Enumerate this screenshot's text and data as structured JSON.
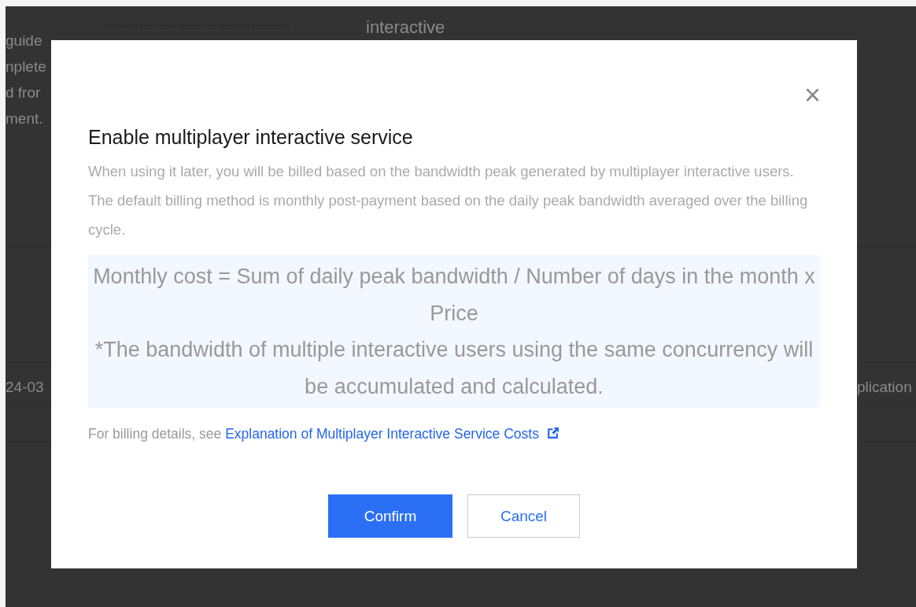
{
  "background_page": {
    "heading": "interactive",
    "left_text_fragments": [
      "guide",
      "nplete",
      "d fror",
      "ment."
    ],
    "table_cell_left": "24-03",
    "table_cell_right": "plication"
  },
  "dialog": {
    "close_symbol": "×",
    "title": "Enable multiplayer interactive service",
    "description": "When using it later, you will be billed based on the bandwidth peak generated by multiplayer interactive users. The default billing method is monthly post-payment based on the daily peak bandwidth averaged over the billing cycle.",
    "formula_lines": [
      "Monthly cost = Sum of daily peak bandwidth / Number of days in the month x Price",
      "*The bandwidth of multiple interactive users using the same concurrency will be accumulated and calculated."
    ],
    "billing_note": "For billing details, see",
    "billing_link": "Explanation of Multiplayer Interactive Service Costs",
    "buttons": [
      {
        "label": "Confirm",
        "kind": "primary"
      },
      {
        "label": "Cancel",
        "kind": "secondary"
      }
    ]
  }
}
